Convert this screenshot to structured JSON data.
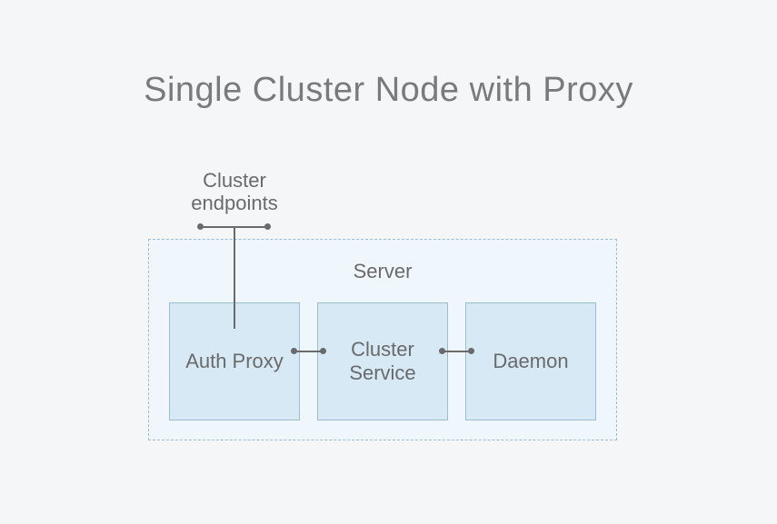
{
  "title": "Single Cluster Node with Proxy",
  "endpointsLabel": "Cluster endpoints",
  "server": {
    "label": "Server",
    "nodes": {
      "authProxy": "Auth Proxy",
      "clusterService": "Cluster Service",
      "daemon": "Daemon"
    }
  }
}
